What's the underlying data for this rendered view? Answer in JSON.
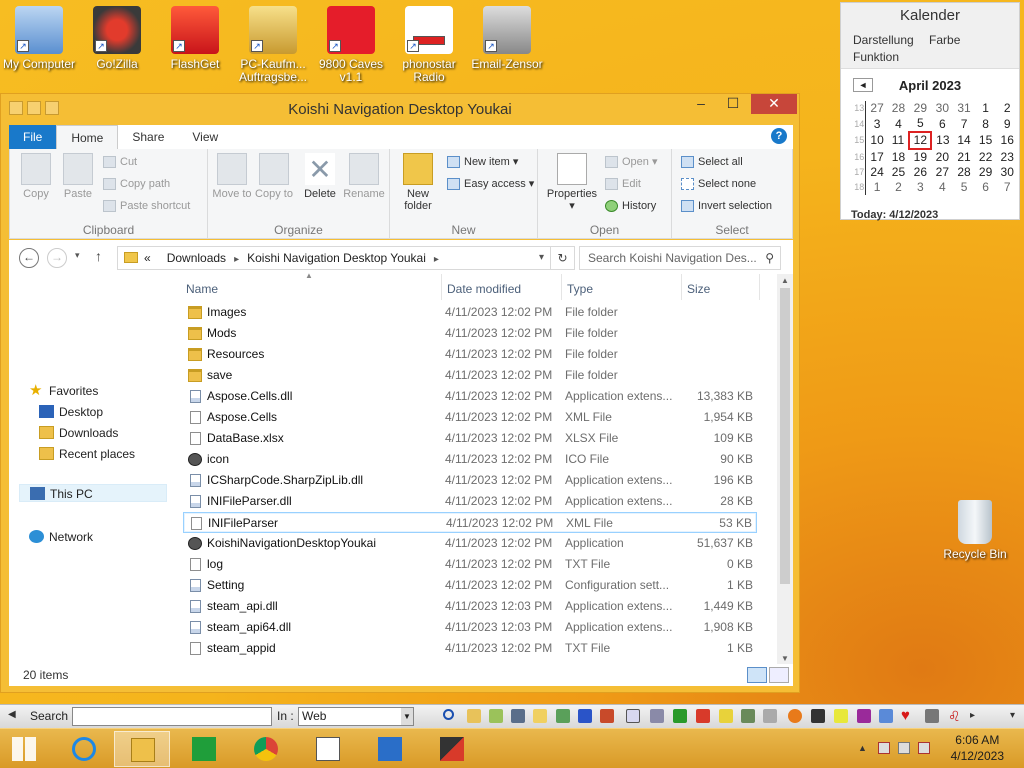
{
  "desktop": {
    "icons": [
      {
        "label": "My Computer"
      },
      {
        "label": "Go!Zilla"
      },
      {
        "label": "FlashGet"
      },
      {
        "label": "PC-Kaufm... Auftragsbe..."
      },
      {
        "label": "9800 Caves v1.1"
      },
      {
        "label": "phonostar Radio"
      },
      {
        "label": "Email-Zensor"
      }
    ],
    "recycle_bin": "Recycle Bin"
  },
  "calendar": {
    "title": "Kalender",
    "menu": [
      "Darstellung",
      "Farbe",
      "Funktion"
    ],
    "month": "April 2023",
    "prev": "◄",
    "weeks": [
      {
        "w": "13",
        "days": [
          "27",
          "28",
          "29",
          "30",
          "31",
          "1",
          "2"
        ]
      },
      {
        "w": "14",
        "days": [
          "3",
          "4",
          "5",
          "6",
          "7",
          "8",
          "9"
        ]
      },
      {
        "w": "15",
        "days": [
          "10",
          "11",
          "12",
          "13",
          "14",
          "15",
          "16"
        ]
      },
      {
        "w": "16",
        "days": [
          "17",
          "18",
          "19",
          "20",
          "21",
          "22",
          "23"
        ]
      },
      {
        "w": "17",
        "days": [
          "24",
          "25",
          "26",
          "27",
          "28",
          "29",
          "30"
        ]
      },
      {
        "w": "18",
        "days": [
          "1",
          "2",
          "3",
          "4",
          "5",
          "6",
          "7"
        ]
      }
    ],
    "today_label": "Today: 4/12/2023"
  },
  "window": {
    "title": "Koishi Navigation Desktop Youkai",
    "controls": {
      "minimize": "–",
      "maximize": "☐",
      "close": "✕"
    },
    "tabs": [
      "File",
      "Home",
      "Share",
      "View"
    ],
    "help": "?",
    "ribbon": {
      "clipboard": {
        "label": "Clipboard",
        "copy": "Copy",
        "paste": "Paste",
        "cut": "Cut",
        "copy_path": "Copy path",
        "paste_shortcut": "Paste shortcut"
      },
      "organize": {
        "label": "Organize",
        "move_to": "Move to",
        "copy_to": "Copy to",
        "delete": "Delete",
        "rename": "Rename"
      },
      "new": {
        "label": "New",
        "new_folder": "New folder",
        "new_item": "New item",
        "easy_access": "Easy access"
      },
      "open": {
        "label": "Open",
        "properties": "Properties",
        "open": "Open",
        "edit": "Edit",
        "history": "History"
      },
      "select": {
        "label": "Select",
        "select_all": "Select all",
        "select_none": "Select none",
        "invert": "Invert selection"
      }
    },
    "address": {
      "crumbs": [
        "Downloads",
        "Koishi Navigation Desktop Youkai"
      ],
      "search_placeholder": "Search Koishi Navigation Des..."
    },
    "nav": {
      "favorites": "Favorites",
      "desktop": "Desktop",
      "downloads": "Downloads",
      "recent": "Recent places",
      "this_pc": "This PC",
      "network": "Network"
    },
    "columns": {
      "name": "Name",
      "date": "Date modified",
      "type": "Type",
      "size": "Size"
    },
    "files": [
      {
        "name": "Images",
        "date": "4/11/2023 12:02 PM",
        "type": "File folder",
        "size": "",
        "icon": "folder"
      },
      {
        "name": "Mods",
        "date": "4/11/2023 12:02 PM",
        "type": "File folder",
        "size": "",
        "icon": "folder"
      },
      {
        "name": "Resources",
        "date": "4/11/2023 12:02 PM",
        "type": "File folder",
        "size": "",
        "icon": "folder"
      },
      {
        "name": "save",
        "date": "4/11/2023 12:02 PM",
        "type": "File folder",
        "size": "",
        "icon": "folder"
      },
      {
        "name": "Aspose.Cells.dll",
        "date": "4/11/2023 12:02 PM",
        "type": "Application extens...",
        "size": "13,383 KB",
        "icon": "dll"
      },
      {
        "name": "Aspose.Cells",
        "date": "4/11/2023 12:02 PM",
        "type": "XML File",
        "size": "1,954 KB",
        "icon": "doc"
      },
      {
        "name": "DataBase.xlsx",
        "date": "4/11/2023 12:02 PM",
        "type": "XLSX File",
        "size": "109 KB",
        "icon": "doc"
      },
      {
        "name": "icon",
        "date": "4/11/2023 12:02 PM",
        "type": "ICO File",
        "size": "90 KB",
        "icon": "app"
      },
      {
        "name": "ICSharpCode.SharpZipLib.dll",
        "date": "4/11/2023 12:02 PM",
        "type": "Application extens...",
        "size": "196 KB",
        "icon": "dll"
      },
      {
        "name": "INIFileParser.dll",
        "date": "4/11/2023 12:02 PM",
        "type": "Application extens...",
        "size": "28 KB",
        "icon": "dll"
      },
      {
        "name": "INIFileParser",
        "date": "4/11/2023 12:02 PM",
        "type": "XML File",
        "size": "53 KB",
        "icon": "doc"
      },
      {
        "name": "KoishiNavigationDesktopYoukai",
        "date": "4/11/2023 12:02 PM",
        "type": "Application",
        "size": "51,637 KB",
        "icon": "app"
      },
      {
        "name": "log",
        "date": "4/11/2023 12:02 PM",
        "type": "TXT File",
        "size": "0 KB",
        "icon": "doc"
      },
      {
        "name": "Setting",
        "date": "4/11/2023 12:02 PM",
        "type": "Configuration sett...",
        "size": "1 KB",
        "icon": "dll"
      },
      {
        "name": "steam_api.dll",
        "date": "4/11/2023 12:03 PM",
        "type": "Application extens...",
        "size": "1,449 KB",
        "icon": "dll"
      },
      {
        "name": "steam_api64.dll",
        "date": "4/11/2023 12:03 PM",
        "type": "Application extens...",
        "size": "1,908 KB",
        "icon": "dll"
      },
      {
        "name": "steam_appid",
        "date": "4/11/2023 12:02 PM",
        "type": "TXT File",
        "size": "1 KB",
        "icon": "doc"
      }
    ],
    "selected_file": "INIFileParser",
    "status": "20 items"
  },
  "search_toolbar": {
    "search_label": "Search :",
    "in_label": "In :",
    "in_value": "Web"
  },
  "taskbar": {
    "time": "6:06 AM",
    "date": "4/12/2023"
  }
}
